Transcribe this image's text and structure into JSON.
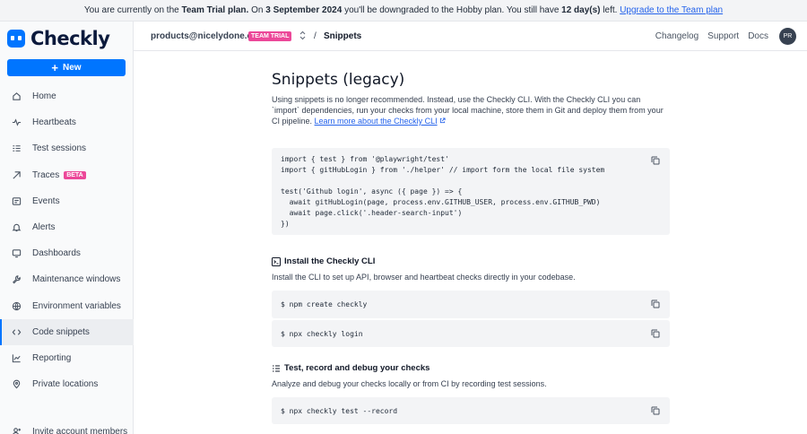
{
  "banner": {
    "p1": "You are currently on the ",
    "plan": "Team Trial plan.",
    "p2": " On ",
    "date": "3 September 2024",
    "p3": " you'll be downgraded to the Hobby plan. You still have ",
    "days": "12 day(s)",
    "p4": " left. ",
    "link": "Upgrade to the Team plan"
  },
  "sidebar": {
    "logo": "Checkly",
    "new_label": "New",
    "items": [
      {
        "label": "Home",
        "icon": "home-icon"
      },
      {
        "label": "Heartbeats",
        "icon": "heartbeat-icon"
      },
      {
        "label": "Test sessions",
        "icon": "test-sessions-icon"
      },
      {
        "label": "Traces",
        "icon": "traces-icon",
        "badge": "BETA"
      },
      {
        "label": "Events",
        "icon": "events-icon"
      },
      {
        "label": "Alerts",
        "icon": "bell-icon"
      },
      {
        "label": "Dashboards",
        "icon": "monitor-icon"
      },
      {
        "label": "Maintenance windows",
        "icon": "wrench-icon"
      },
      {
        "label": "Environment variables",
        "icon": "globe-icon"
      },
      {
        "label": "Code snippets",
        "icon": "code-icon",
        "active": true
      },
      {
        "label": "Reporting",
        "icon": "chart-icon"
      },
      {
        "label": "Private locations",
        "icon": "location-pin-icon"
      }
    ],
    "invite": "Invite account members"
  },
  "topbar": {
    "account": "products@nicelydone.cl...",
    "badge": "TEAM TRIAL",
    "separator": "/",
    "crumb": "Snippets",
    "links": [
      "Changelog",
      "Support",
      "Docs"
    ],
    "avatar": "PR"
  },
  "main": {
    "title": "Snippets (legacy)",
    "intro": "Using snippets is no longer recommended. Instead, use the Checkly CLI. With the Checkly CLI you can `import` dependencies, run your checks from your local machine, store them in Git and deploy them from your CI pipeline. ",
    "intro_link": "Learn more about the Checkly CLI",
    "code_lines": [
      "import { test } from '@playwright/test'",
      "import { gitHubLogin } from './helper' // import form the local file system",
      "",
      "test('Github login', async ({ page }) => {",
      "  await gitHubLogin(page, process.env.GITHUB_USER, process.env.GITHUB_PWD)",
      "  await page.click('.header-search-input')",
      "})"
    ],
    "install_title": "Install the Checkly CLI",
    "install_desc": "Install the CLI to set up API, browser and heartbeat checks directly in your codebase.",
    "cmd1": "$ npm create checkly",
    "cmd2": "$ npx checkly login",
    "test_title": "Test, record and debug your checks",
    "test_desc": "Analyze and debug your checks locally or from CI by recording test sessions.",
    "cmd3": "$ npx checkly test --record"
  }
}
